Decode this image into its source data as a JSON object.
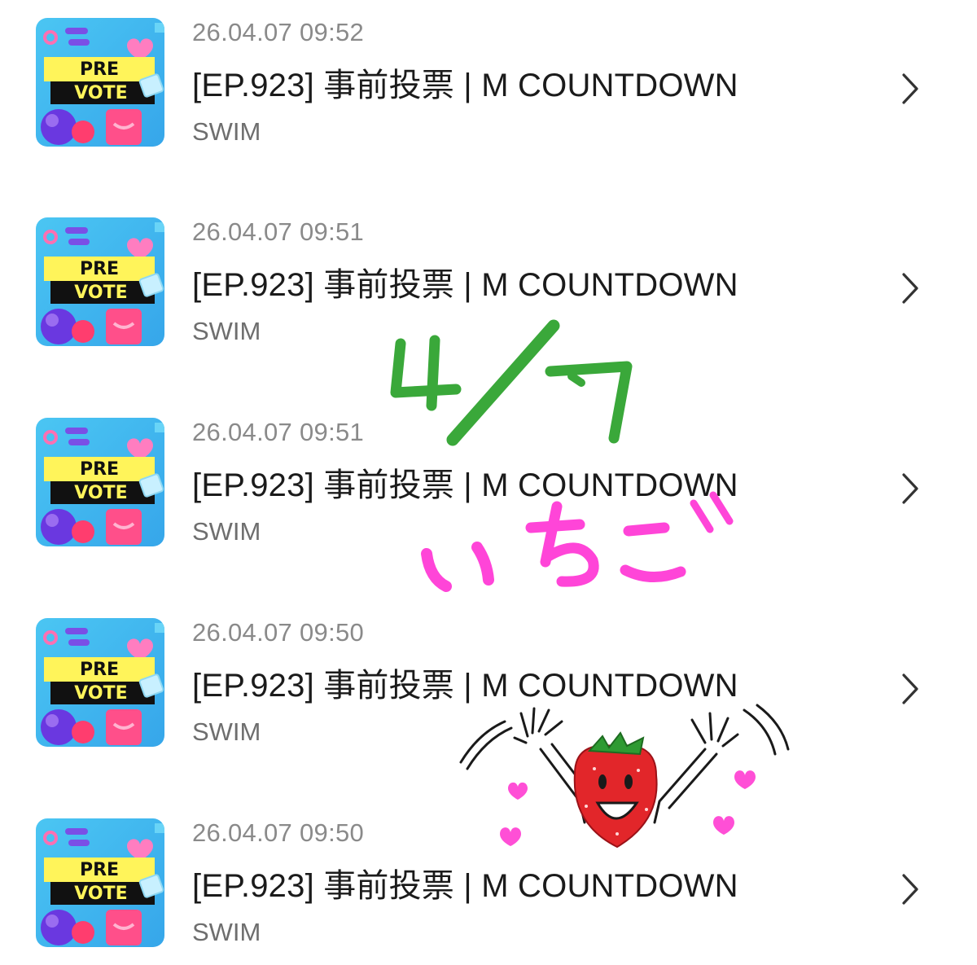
{
  "items": [
    {
      "timestamp": "26.04.07 09:52",
      "title": "[EP.923] 事前投票 | M COUNTDOWN",
      "channel": "SWIM",
      "thumb_top": "PRE",
      "thumb_bottom": "VOTE"
    },
    {
      "timestamp": "26.04.07 09:51",
      "title": "[EP.923] 事前投票 | M COUNTDOWN",
      "channel": "SWIM",
      "thumb_top": "PRE",
      "thumb_bottom": "VOTE"
    },
    {
      "timestamp": "26.04.07 09:51",
      "title": "[EP.923] 事前投票 | M COUNTDOWN",
      "channel": "SWIM",
      "thumb_top": "PRE",
      "thumb_bottom": "VOTE"
    },
    {
      "timestamp": "26.04.07 09:50",
      "title": "[EP.923] 事前投票 | M COUNTDOWN",
      "channel": "SWIM",
      "thumb_top": "PRE",
      "thumb_bottom": "VOTE"
    },
    {
      "timestamp": "26.04.07 09:50",
      "title": "[EP.923] 事前投票 | M COUNTDOWN",
      "channel": "SWIM",
      "thumb_top": "PRE",
      "thumb_bottom": "VOTE"
    }
  ],
  "icons": {
    "chevron": "chevron-right-icon"
  },
  "annotations": {
    "date_handwriting": "4/7",
    "word_handwriting": "いちご"
  },
  "colors": {
    "timestamp": "#8a8a8a",
    "title": "#1b1b1b",
    "channel": "#6e6e6e",
    "handwriting_green": "#3aa83a",
    "handwriting_pink": "#ff45d8",
    "strawberry_red": "#e2262a",
    "hearts": "#ff4fd6"
  }
}
